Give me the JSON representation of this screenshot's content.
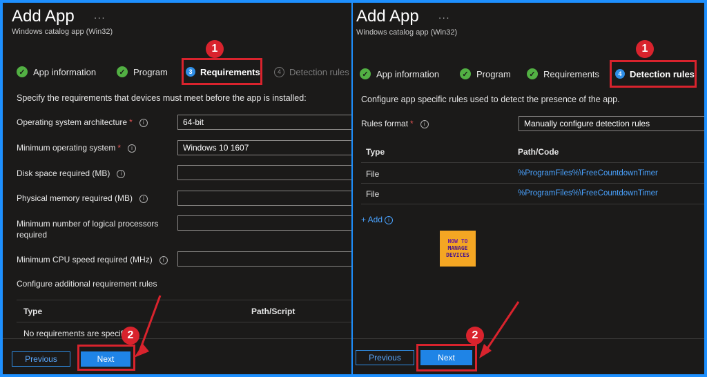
{
  "left": {
    "title": "Add App",
    "title_menu": "···",
    "subtitle": "Windows catalog app (Win32)",
    "steps": [
      {
        "label": "App information",
        "status": "complete"
      },
      {
        "label": "Program",
        "status": "complete"
      },
      {
        "label": "Requirements",
        "status": "active",
        "number": "3"
      },
      {
        "label": "Detection rules",
        "status": "pending",
        "number": "4"
      }
    ],
    "intro": "Specify the requirements that devices must meet before the app is installed:",
    "fields": [
      {
        "label": "Operating system architecture",
        "required": "*",
        "value": "64-bit"
      },
      {
        "label": "Minimum operating system",
        "required": "*",
        "value": "Windows 10 1607"
      },
      {
        "label": "Disk space required (MB)",
        "value": ""
      },
      {
        "label": "Physical memory required (MB)",
        "value": ""
      },
      {
        "label_line1": "Minimum number of logical processors",
        "label_line2": "required",
        "value": ""
      },
      {
        "label": "Minimum CPU speed required (MHz)",
        "value": ""
      }
    ],
    "additional_rules_label": "Configure additional requirement rules",
    "table_headers": [
      "Type",
      "Path/Script"
    ],
    "table_empty": "No requirements are specif",
    "previous_label": "Previous",
    "next_label": "Next",
    "callout_1": "1",
    "callout_2": "2"
  },
  "right": {
    "title": "Add App",
    "title_menu": "···",
    "subtitle": "Windows catalog app (Win32)",
    "steps": [
      {
        "label": "App information",
        "status": "complete"
      },
      {
        "label": "Program",
        "status": "complete"
      },
      {
        "label": "Requirements",
        "status": "complete"
      },
      {
        "label": "Detection rules",
        "status": "active",
        "number": "4"
      }
    ],
    "intro": "Configure app specific rules used to detect the presence of the app.",
    "rules_format_label": "Rules format",
    "rules_format_required": "*",
    "rules_format_value": "Manually configure detection rules",
    "table_headers": [
      "Type",
      "Path/Code"
    ],
    "rows": [
      {
        "type": "File",
        "path": "%ProgramFiles%\\FreeCountdownTimer"
      },
      {
        "type": "File",
        "path": "%ProgramFiles%\\FreeCountdownTimer"
      }
    ],
    "add_label": "+ Add",
    "previous_label": "Previous",
    "next_label": "Next",
    "callout_1": "1",
    "callout_2": "2"
  },
  "logo": {
    "line1": "HOW TO",
    "line2": "MANAGE",
    "line3": "DEVICES"
  },
  "colors": {
    "accent": "#1f84e6",
    "highlight": "#d9232d",
    "complete": "#52b043",
    "link": "#4aa3ff"
  }
}
